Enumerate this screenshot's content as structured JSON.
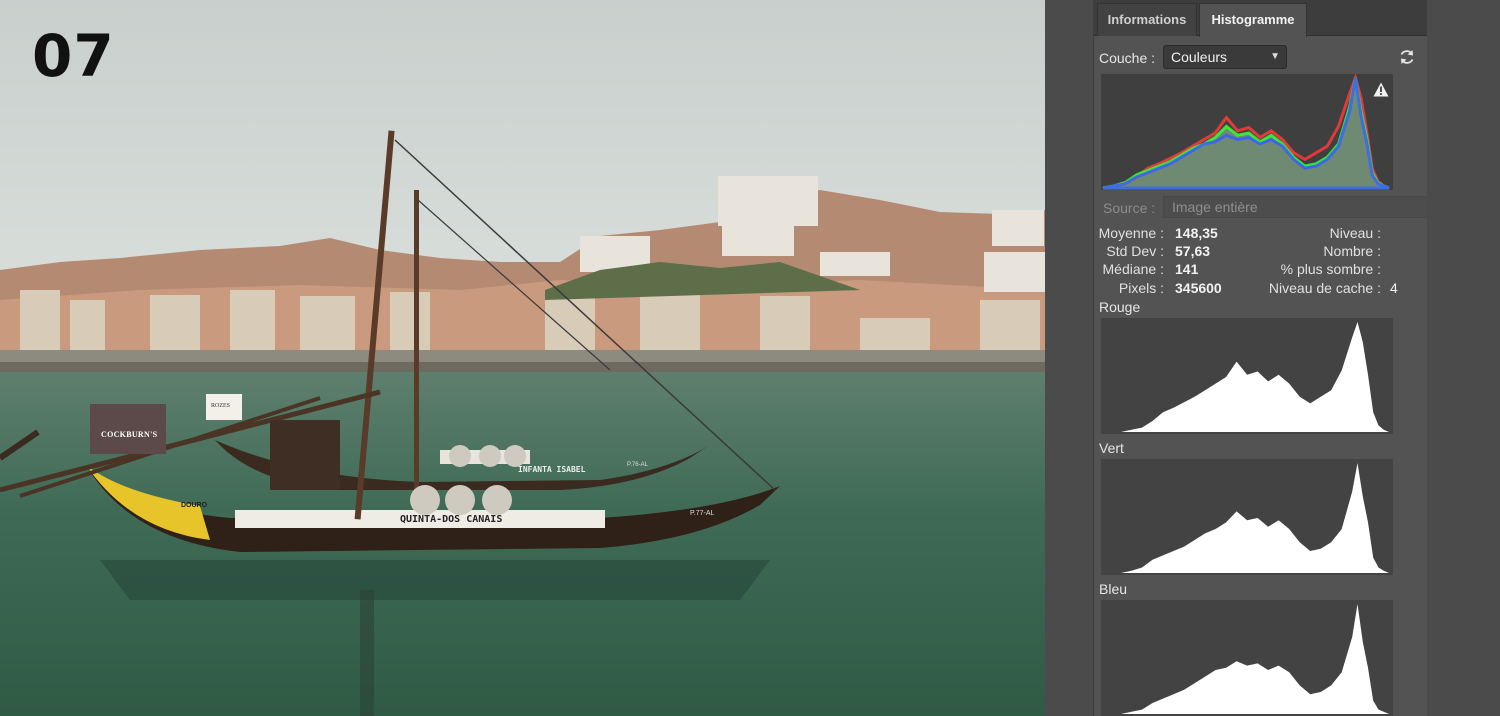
{
  "step_number": "07",
  "photo": {
    "sign_boat_flag": "COCKBURN'S",
    "sign_small_flag": "ROZES",
    "boat_front_name": "QUINTA-DOS CANAIS",
    "boat_front_bow_text": "DOURO",
    "boat_front_reg": "P.77-AL",
    "boat_back_name": "INFANTA ISABEL",
    "boat_back_reg": "P.76-AL"
  },
  "panel": {
    "tabs": [
      {
        "label": "Informations",
        "active": false
      },
      {
        "label": "Histogramme",
        "active": true
      }
    ],
    "channel_label": "Couche :",
    "channel_value": "Couleurs",
    "source_label": "Source :",
    "source_value": "Image entière",
    "stats_left": [
      {
        "label": "Moyenne :",
        "value": "148,35"
      },
      {
        "label": "Std Dev :",
        "value": "57,63"
      },
      {
        "label": "Médiane :",
        "value": "141"
      },
      {
        "label": "Pixels :",
        "value": "345600"
      }
    ],
    "stats_right": [
      {
        "label": "Niveau :",
        "value": ""
      },
      {
        "label": "Nombre :",
        "value": ""
      },
      {
        "label": "% plus sombre :",
        "value": ""
      },
      {
        "label": "Niveau de cache :",
        "value": "4"
      }
    ],
    "channels": [
      {
        "label": "Rouge"
      },
      {
        "label": "Vert"
      },
      {
        "label": "Bleu"
      }
    ],
    "icons": [
      "refresh-icon",
      "warning-icon",
      "chevron-down-icon"
    ],
    "colors": {
      "panel_bg": "#535353",
      "histogram_fill": "#ffffff",
      "composite_gray": "#6f8a73"
    }
  },
  "chart_data": {
    "type": "area",
    "x_range": [
      0,
      255
    ],
    "series": [
      {
        "name": "Rouge",
        "x": [
          0,
          10,
          20,
          30,
          40,
          50,
          60,
          70,
          80,
          90,
          100,
          110,
          120,
          130,
          140,
          150,
          160,
          170,
          180,
          190,
          200,
          210,
          220,
          225,
          230,
          235,
          240,
          245,
          250,
          255
        ],
        "values": [
          0,
          2,
          4,
          10,
          18,
          22,
          27,
          32,
          38,
          44,
          50,
          64,
          52,
          55,
          46,
          52,
          44,
          32,
          26,
          32,
          38,
          56,
          86,
          100,
          82,
          52,
          18,
          6,
          2,
          0
        ]
      },
      {
        "name": "Vert",
        "x": [
          0,
          10,
          20,
          30,
          40,
          50,
          60,
          70,
          80,
          90,
          100,
          110,
          120,
          130,
          140,
          150,
          160,
          170,
          180,
          190,
          200,
          210,
          220,
          225,
          230,
          235,
          240,
          245,
          250,
          255
        ],
        "values": [
          0,
          2,
          5,
          12,
          16,
          20,
          24,
          30,
          36,
          40,
          46,
          56,
          48,
          50,
          42,
          48,
          40,
          28,
          20,
          22,
          28,
          40,
          74,
          100,
          70,
          46,
          14,
          5,
          2,
          0
        ]
      },
      {
        "name": "Bleu",
        "x": [
          0,
          10,
          20,
          30,
          40,
          50,
          60,
          70,
          80,
          90,
          100,
          110,
          120,
          130,
          140,
          150,
          160,
          170,
          180,
          190,
          200,
          210,
          220,
          225,
          230,
          235,
          240,
          245,
          250,
          255
        ],
        "values": [
          0,
          2,
          4,
          10,
          14,
          18,
          22,
          28,
          34,
          40,
          42,
          48,
          44,
          46,
          40,
          44,
          38,
          26,
          18,
          20,
          26,
          38,
          70,
          100,
          66,
          42,
          12,
          4,
          2,
          0
        ]
      }
    ]
  }
}
